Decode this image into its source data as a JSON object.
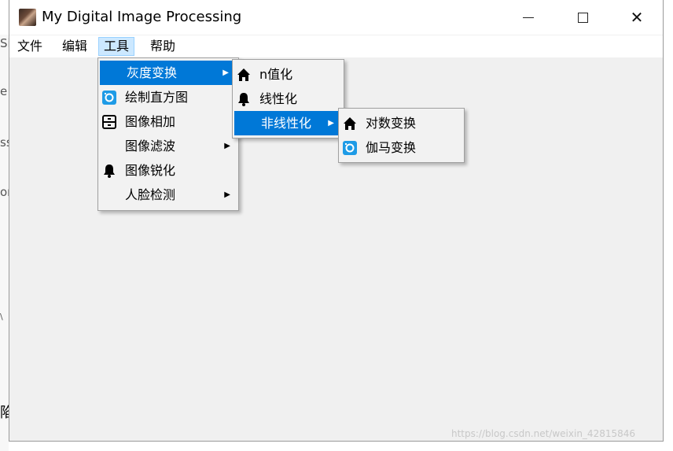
{
  "window": {
    "title": "My Digital Image Processing",
    "controls": {
      "minimize": "minimize",
      "maximize": "maximize",
      "close": "✕"
    }
  },
  "menubar": {
    "items": [
      {
        "label": "文件"
      },
      {
        "label": "编辑"
      },
      {
        "label": "工具"
      },
      {
        "label": "帮助"
      }
    ]
  },
  "tools_menu": {
    "items": [
      {
        "label": "灰度变换",
        "icon": null,
        "submenu": true,
        "highlighted": true
      },
      {
        "label": "绘制直方图",
        "icon": "camera-icon",
        "submenu": false
      },
      {
        "label": "图像相加",
        "icon": "panel-icon",
        "submenu": false
      },
      {
        "label": "图像滤波",
        "icon": null,
        "submenu": true
      },
      {
        "label": "图像锐化",
        "icon": "bell-icon",
        "submenu": false
      },
      {
        "label": "人脸检测",
        "icon": null,
        "submenu": true
      }
    ]
  },
  "gray_submenu": {
    "items": [
      {
        "label": "n值化",
        "icon": "home-icon",
        "submenu": false
      },
      {
        "label": "线性化",
        "icon": "bell-icon",
        "submenu": false
      },
      {
        "label": "非线性化",
        "icon": null,
        "submenu": true,
        "highlighted": true
      }
    ]
  },
  "nonlinear_submenu": {
    "items": [
      {
        "label": "对数变换",
        "icon": "home-icon"
      },
      {
        "label": "伽马变换",
        "icon": "camera-icon"
      }
    ]
  },
  "background": {
    "fragments": [
      "Si",
      "e",
      "ss",
      "on",
      "\\",
      "陷"
    ]
  },
  "watermark": "https://blog.csdn.net/weixin_42815846",
  "colors": {
    "highlight": "#0078d7",
    "menubar_active": "#cce8ff",
    "camera_icon": "#1e9be6"
  }
}
